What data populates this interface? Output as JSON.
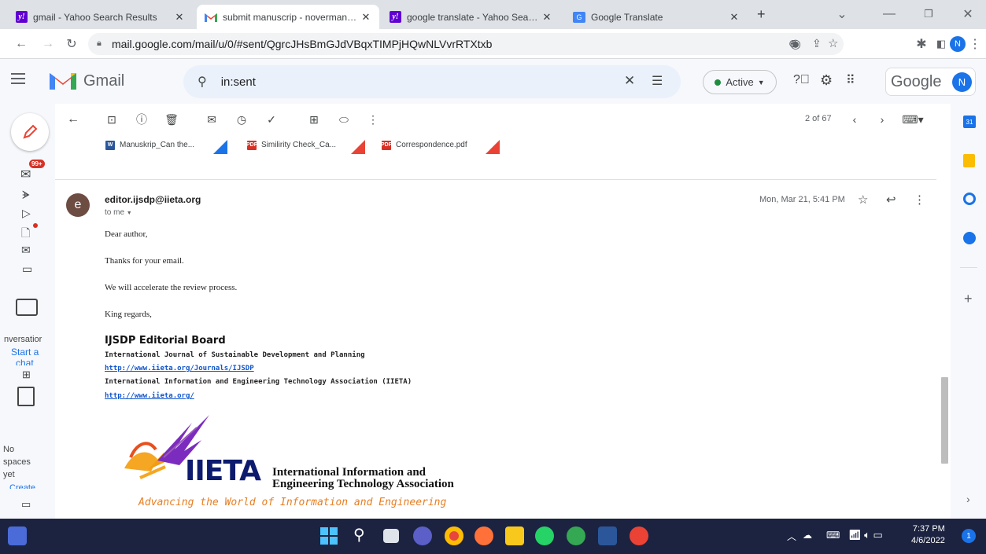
{
  "browser": {
    "tabs": [
      {
        "title": "gmail - Yahoo Search Results",
        "favicon": "yahoo-icon",
        "active": false
      },
      {
        "title": "submit manuscrip - noverman.du",
        "favicon": "gmail-icon",
        "active": true
      },
      {
        "title": "google translate - Yahoo Search",
        "favicon": "yahoo-icon",
        "active": false
      },
      {
        "title": "Google Translate",
        "favicon": "translate-icon",
        "active": false
      }
    ],
    "url": "mail.google.com/mail/u/0/#sent/QgrcJHsBmGJdVBqxTIMPjHQwNLVvrRTXtxb",
    "profile_initial": "N"
  },
  "gmail": {
    "app_name": "Gmail",
    "search_value": "in:sent",
    "status_label": "Active",
    "google_label": "Google",
    "avatar_initial": "N",
    "unread_badge": "99+",
    "pagination": "2 of 67"
  },
  "rail": {
    "chat_partial": "nversatior",
    "start_chat": "Start a",
    "chat_cut": "chat",
    "no_spaces": [
      "No",
      "spaces",
      "yet"
    ],
    "create_cut": "Create"
  },
  "attachments": [
    {
      "name": "Manuskrip_Can the...",
      "type": "W"
    },
    {
      "name": "Similirity Check_Ca...",
      "type": "PDF"
    },
    {
      "name": "Correspondence.pdf",
      "type": "PDF"
    }
  ],
  "message": {
    "sender_initial": "e",
    "sender": "editor.ijsdp@iieta.org",
    "to": "to me",
    "date": "Mon, Mar 21, 5:41 PM",
    "body": [
      "Dear author,",
      "Thanks for your email.",
      "We will accelerate the review process.",
      "King regards,"
    ],
    "signature": {
      "title": "IJSDP Editorial Board",
      "journal": "International Journal of Sustainable Development and Planning",
      "journal_url": "http://www.iieta.org/Journals/IJSDP",
      "association": "International Information and Engineering Technology Association (IIETA)",
      "association_url": "http://www.iieta.org/"
    },
    "logo": {
      "mark": "IIETA",
      "line1": "International Information and",
      "line2": "Engineering Technology Association",
      "tagline": "Advancing the World of Information and Engineering"
    }
  },
  "taskbar": {
    "time": "7:37 PM",
    "date": "4/6/2022",
    "notifications": "1"
  },
  "colors": {
    "gmail_red": "#ea4335",
    "active_green": "#1e8e3e",
    "avatar_blue": "#1a73e8",
    "sender_avatar": "#6d4c41",
    "link_blue": "#1155cc",
    "taskbar": "#1c2340"
  }
}
